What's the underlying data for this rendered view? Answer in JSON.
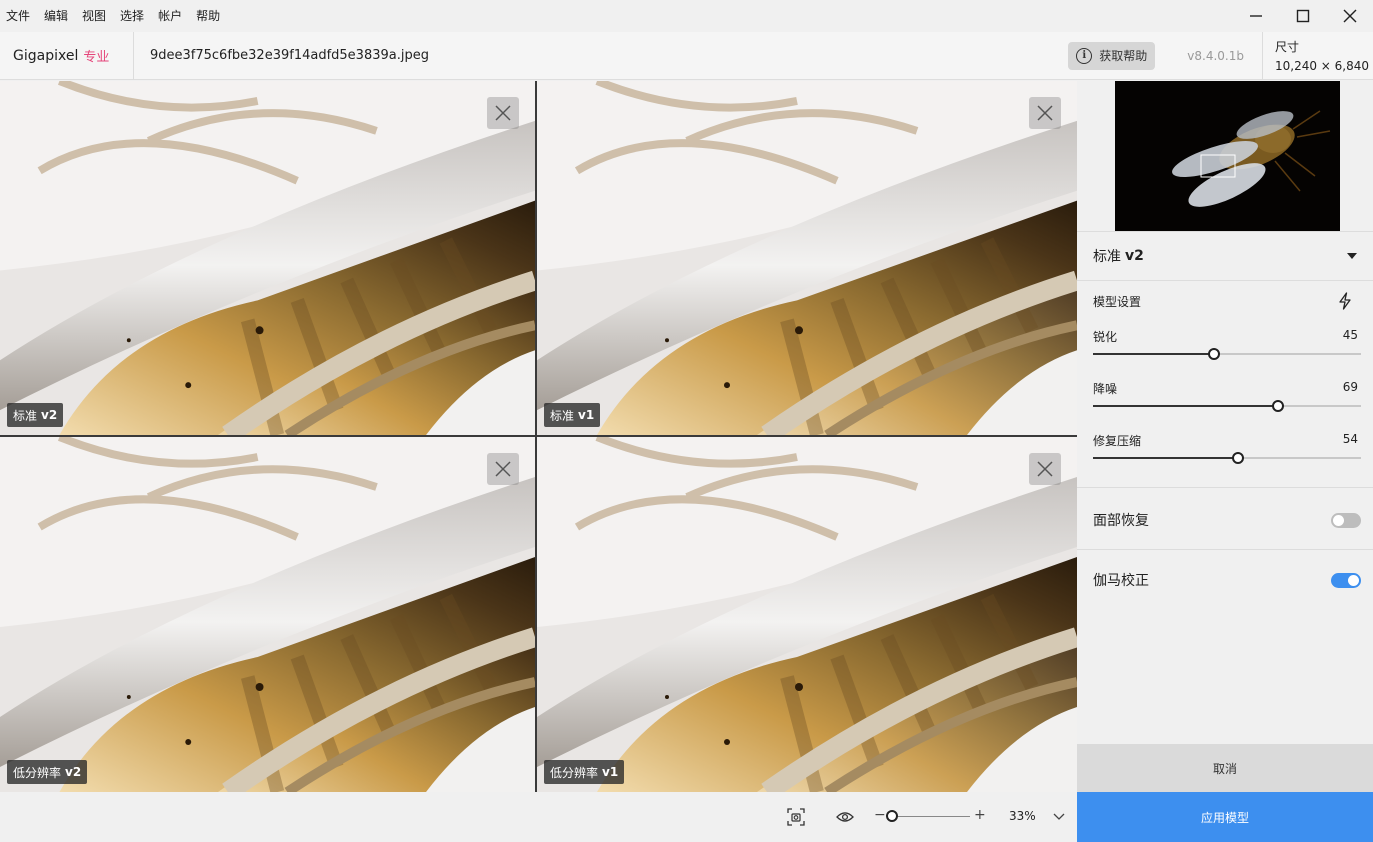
{
  "menu": [
    "文件",
    "编辑",
    "视图",
    "选择",
    "帐户",
    "帮助"
  ],
  "header": {
    "brand": "Gigapixel",
    "brand_tier": "专业",
    "filename": "9dee3f75c6fbe32e39f14adfd5e3839a.jpeg",
    "help_label": "获取帮助",
    "version": "v8.4.0.1b",
    "size_label": "尺寸",
    "size_value": "10,240 × 6,840"
  },
  "tiles": [
    {
      "label": "标准",
      "version": "v2",
      "selected": true
    },
    {
      "label": "标准",
      "version": "v1",
      "selected": false
    },
    {
      "label": "低分辨率",
      "version": "v2",
      "selected": false
    },
    {
      "label": "低分辨率",
      "version": "v1",
      "selected": false
    }
  ],
  "panel": {
    "model_name": "标准",
    "model_version": "v2",
    "settings_title": "模型设置",
    "sliders": [
      {
        "label": "锐化",
        "value": "45",
        "fraction": 0.45
      },
      {
        "label": "降噪",
        "value": "69",
        "fraction": 0.69
      },
      {
        "label": "修复压缩",
        "value": "54",
        "fraction": 0.54
      }
    ],
    "face_recovery": {
      "label": "面部恢复",
      "on": false
    },
    "gamma": {
      "label": "伽马校正",
      "on": true
    },
    "cancel_label": "取消",
    "apply_label": "应用模型",
    "accent": "#3d8fef"
  },
  "bottom": {
    "zoom_minus": "−",
    "zoom_plus": "+",
    "zoom_value": "33%",
    "zoom_fraction": 0.05
  }
}
